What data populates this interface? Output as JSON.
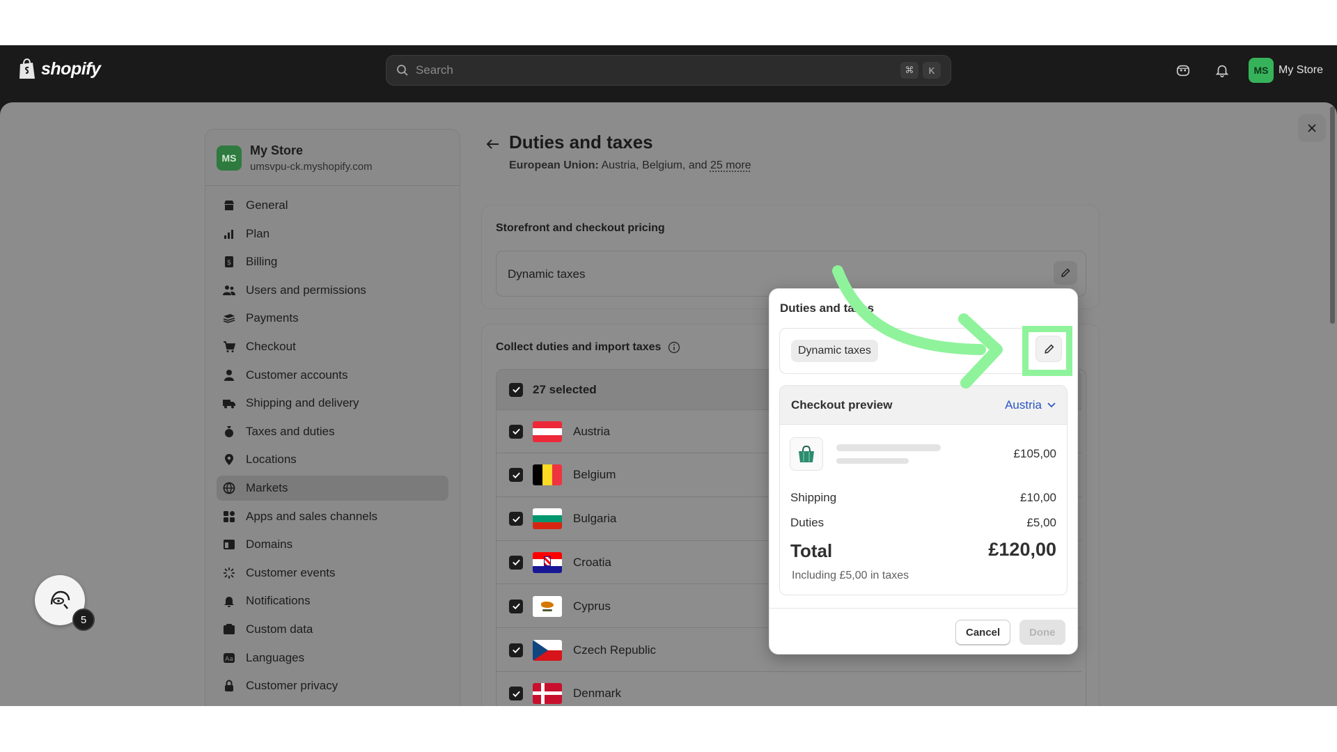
{
  "topbar": {
    "brand": "shopify",
    "search_placeholder": "Search",
    "shortcut_cmd": "⌘",
    "shortcut_key": "K",
    "avatar_initials": "MS",
    "store_label": "My Store"
  },
  "sidebar": {
    "avatar_initials": "MS",
    "store_name": "My Store",
    "store_url": "umsvpu-ck.myshopify.com",
    "items": [
      {
        "label": "General",
        "icon": "store-icon"
      },
      {
        "label": "Plan",
        "icon": "plan-icon"
      },
      {
        "label": "Billing",
        "icon": "billing-icon"
      },
      {
        "label": "Users and permissions",
        "icon": "users-icon"
      },
      {
        "label": "Payments",
        "icon": "payments-icon"
      },
      {
        "label": "Checkout",
        "icon": "cart-icon"
      },
      {
        "label": "Customer accounts",
        "icon": "person-icon"
      },
      {
        "label": "Shipping and delivery",
        "icon": "truck-icon"
      },
      {
        "label": "Taxes and duties",
        "icon": "tax-icon"
      },
      {
        "label": "Locations",
        "icon": "location-icon"
      },
      {
        "label": "Markets",
        "icon": "globe-icon"
      },
      {
        "label": "Apps and sales channels",
        "icon": "apps-icon"
      },
      {
        "label": "Domains",
        "icon": "domains-icon"
      },
      {
        "label": "Customer events",
        "icon": "events-icon"
      },
      {
        "label": "Notifications",
        "icon": "bell-icon"
      },
      {
        "label": "Custom data",
        "icon": "data-icon"
      },
      {
        "label": "Languages",
        "icon": "languages-icon"
      },
      {
        "label": "Customer privacy",
        "icon": "lock-icon"
      }
    ],
    "active_index": 10
  },
  "page": {
    "title": "Duties and taxes",
    "subtitle_region": "European Union:",
    "subtitle_countries": "Austria, Belgium, and",
    "subtitle_more": "25 more"
  },
  "pricing_card": {
    "title": "Storefront and checkout pricing",
    "field_value": "Dynamic taxes"
  },
  "duties_card": {
    "title": "Collect duties and import taxes",
    "selected_label": "27 selected",
    "countries": [
      "Austria",
      "Belgium",
      "Bulgaria",
      "Croatia",
      "Cyprus",
      "Czech Republic",
      "Denmark"
    ]
  },
  "popover": {
    "title": "Duties and taxes",
    "chip": "Dynamic taxes",
    "preview_label": "Checkout preview",
    "preview_country": "Austria",
    "product_price": "£105,00",
    "shipping_label": "Shipping",
    "shipping_value": "£10,00",
    "duties_label": "Duties",
    "duties_value": "£5,00",
    "total_label": "Total",
    "total_value": "£120,00",
    "including": "Including £5,00 in taxes",
    "cancel": "Cancel",
    "done": "Done"
  },
  "helper": {
    "badge": "5"
  },
  "colors": {
    "highlight": "#8ff39b",
    "link": "#2b55c3",
    "topbar": "#1a1a1a"
  }
}
